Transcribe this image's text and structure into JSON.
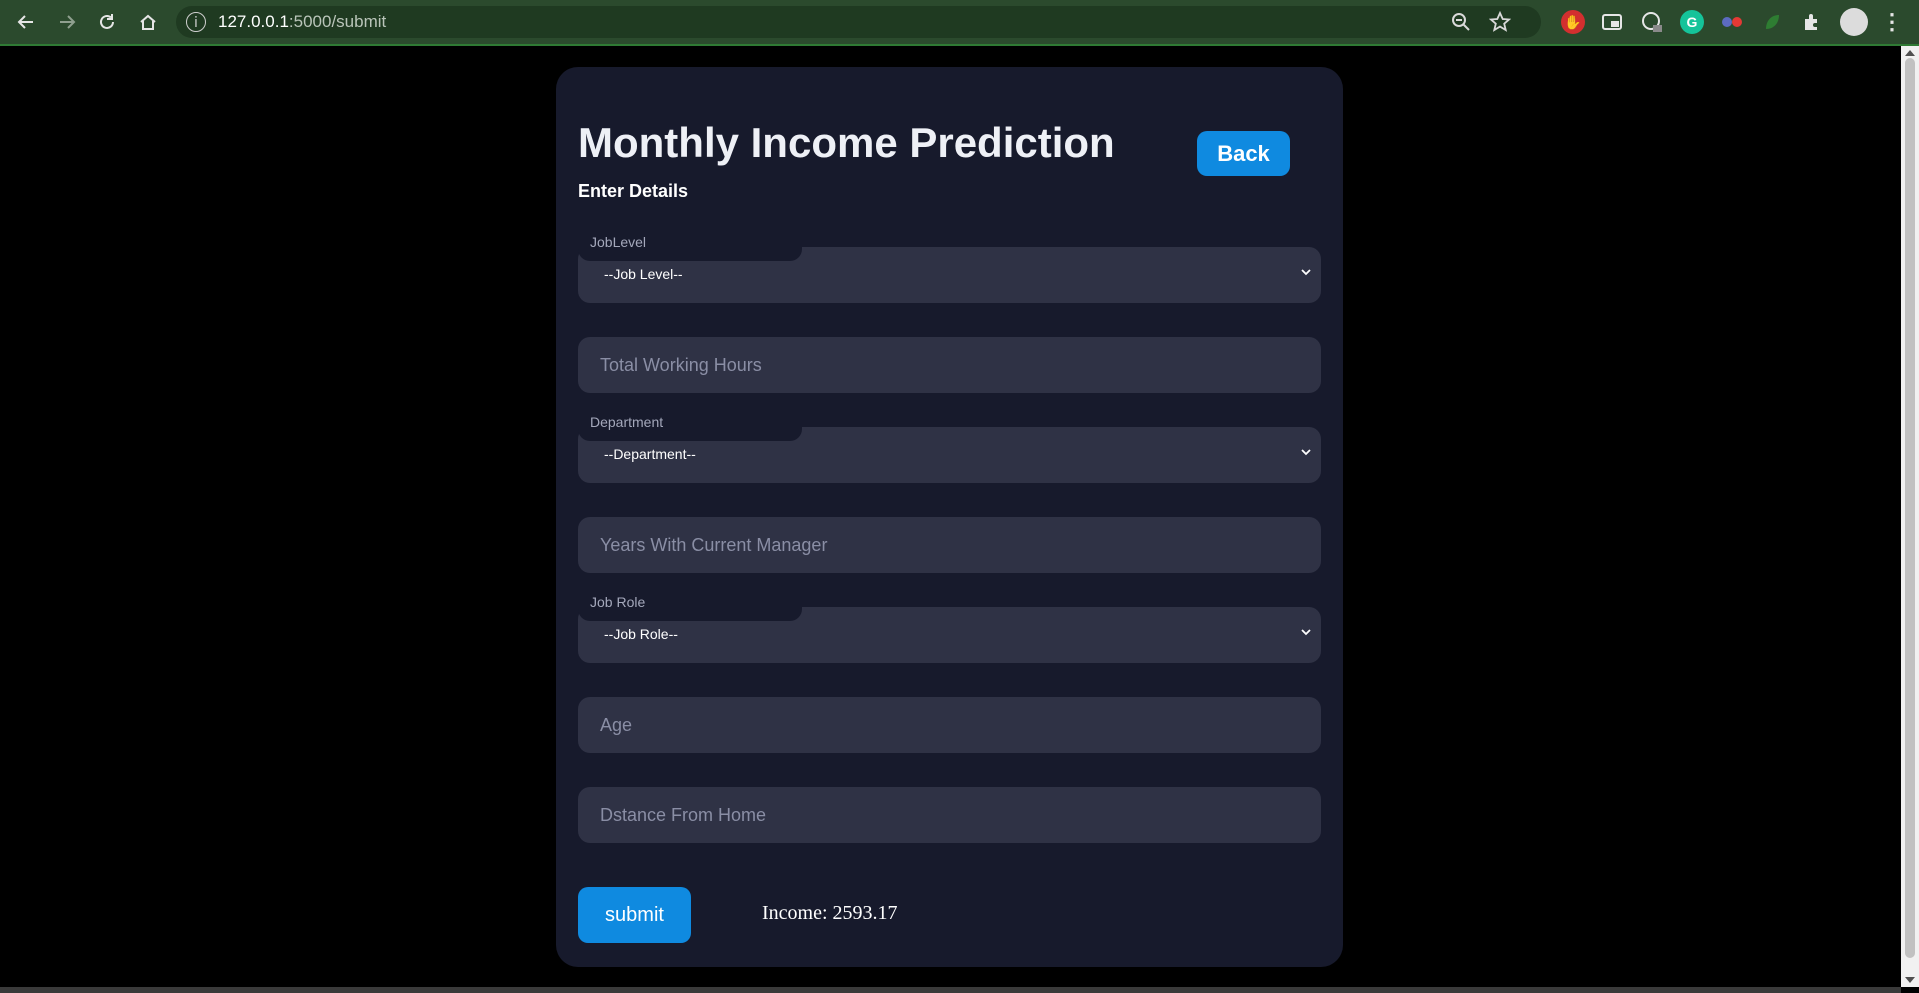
{
  "browser": {
    "url_host": "127.0.0.1",
    "url_path": ":5000/submit"
  },
  "page": {
    "title": "Monthly Income Prediction",
    "back_label": "Back",
    "subtitle": "Enter Details"
  },
  "form": {
    "job_level": {
      "label": "JobLevel",
      "selected": "--Job Level--"
    },
    "total_working_hours": {
      "placeholder": "Total Working Hours"
    },
    "department": {
      "label": "Department",
      "selected": "--Department--"
    },
    "years_with_manager": {
      "placeholder": "Years With Current Manager"
    },
    "job_role": {
      "label": "Job Role",
      "selected": "--Job Role--"
    },
    "age": {
      "placeholder": "Age"
    },
    "distance_from_home": {
      "placeholder": "Dstance From Home"
    },
    "submit_label": "submit"
  },
  "result": {
    "text": "Income: 2593.17"
  },
  "colors": {
    "accent": "#0f8ae0",
    "card_bg": "#171a2c",
    "field_bg": "#2f3245",
    "page_bg": "#000000",
    "browser_bar": "#2b4a2d"
  }
}
